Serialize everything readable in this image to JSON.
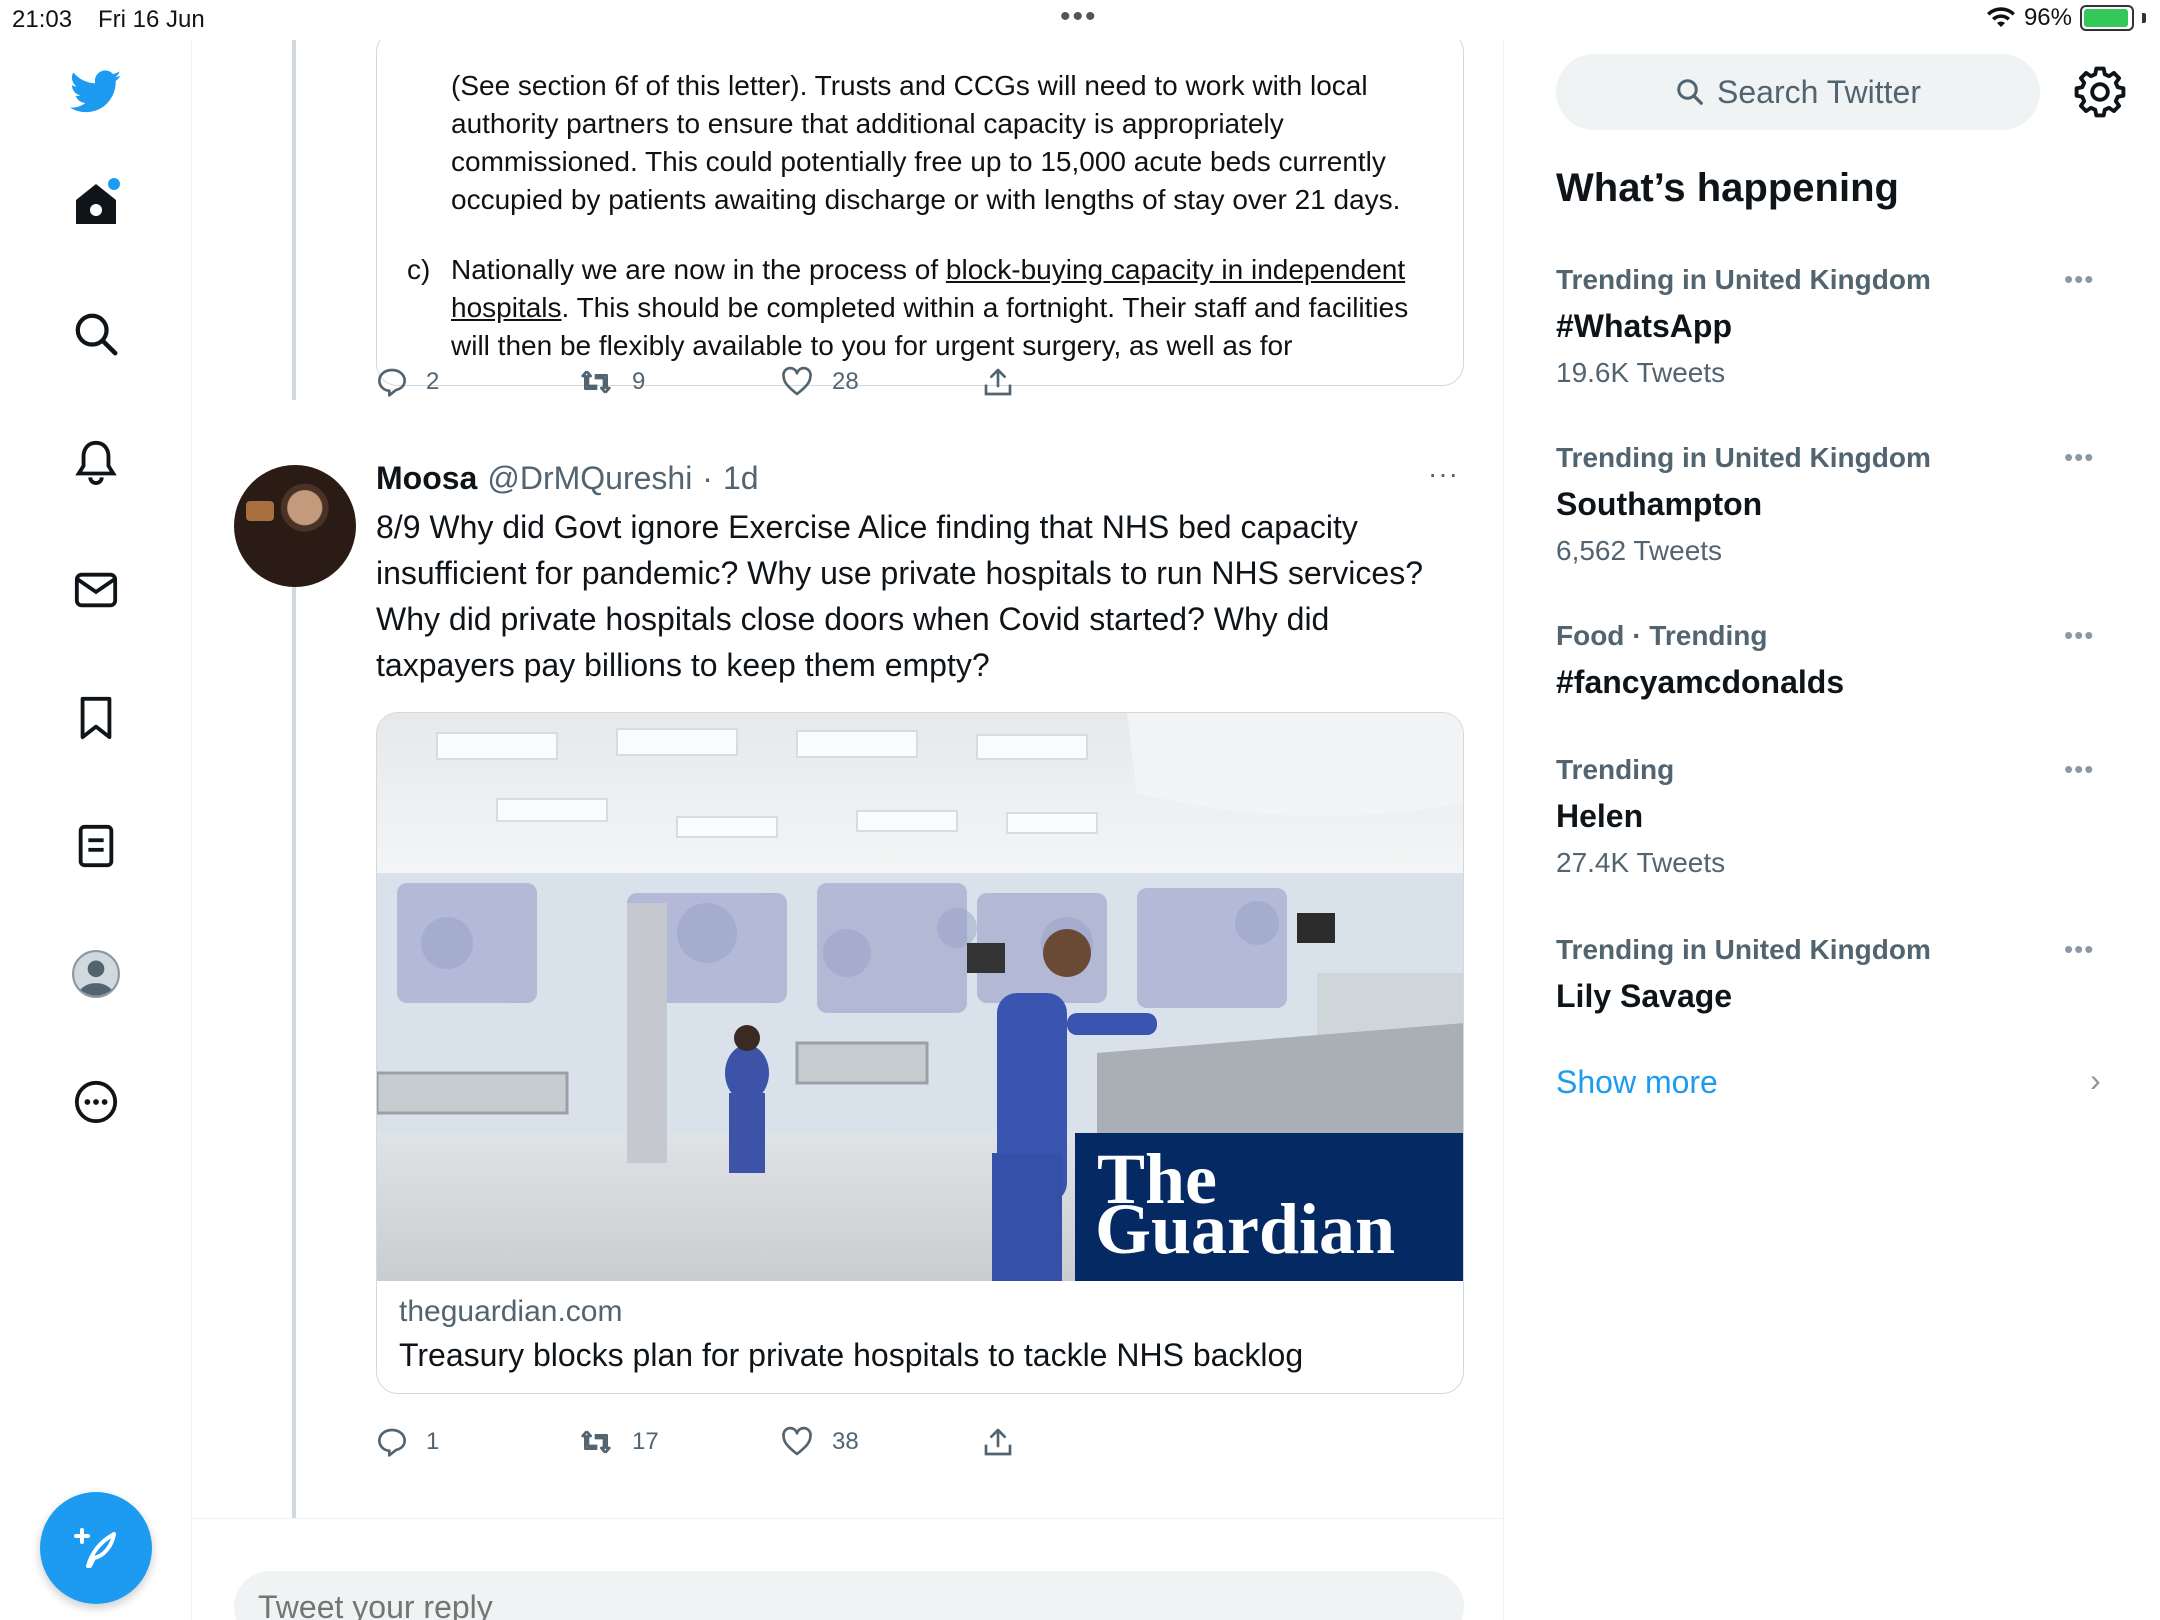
{
  "status_bar": {
    "time": "21:03",
    "date": "Fri 16 Jun",
    "battery": "96%",
    "battery_level": 0.96
  },
  "nav": {
    "items": [
      "twitter-logo",
      "home",
      "explore",
      "notifications",
      "messages",
      "bookmarks",
      "lists",
      "profile",
      "more"
    ],
    "compose_label": "Tweet"
  },
  "doc_excerpt": {
    "para1": "(See section 6f of this letter). Trusts and CCGs will need to work with local authority partners to ensure that additional capacity is appropriately commissioned. This could potentially free up to 15,000 acute beds currently occupied by patients awaiting discharge or with lengths of stay over 21 days.",
    "item_c_label": "c)",
    "item_c_prefix": "Nationally we are now in the process of ",
    "item_c_link": "block-buying capacity in independent hospitals",
    "item_c_rest": ". This should be completed within a fortnight. Their staff and facilities will then be flexibly available to you for urgent surgery, as well as for"
  },
  "tweet1_actions": {
    "replies": "2",
    "retweets": "9",
    "likes": "28"
  },
  "tweet2": {
    "name": "Moosa",
    "handle": "@DrMQureshi",
    "sep": "·",
    "time": "1d",
    "more": "···",
    "text": "8/9 Why did Govt ignore Exercise Alice finding that NHS bed capacity insufficient for pandemic? Why use private hospitals to run NHS services? Why did private hospitals close doors when Covid started? Why did taxpayers pay billions to keep them empty?",
    "card": {
      "logo_line1": "The",
      "logo_line2": "Guardian",
      "domain": "theguardian.com",
      "title": "Treasury blocks plan for private hospitals to tackle NHS backlog"
    },
    "actions": {
      "replies": "1",
      "retweets": "17",
      "likes": "38"
    }
  },
  "reply": {
    "placeholder": "Tweet your reply"
  },
  "sidebar": {
    "search_placeholder": "Search Twitter",
    "section_title": "What’s happening",
    "trends": [
      {
        "context": "Trending in United Kingdom",
        "name": "#WhatsApp",
        "count": "19.6K Tweets"
      },
      {
        "context": "Trending in United Kingdom",
        "name": "Southampton",
        "count": "6,562 Tweets"
      },
      {
        "context": "Food · Trending",
        "name": "#fancyamcdonalds",
        "count": ""
      },
      {
        "context": "Trending",
        "name": "Helen",
        "count": "27.4K Tweets"
      },
      {
        "context": "Trending in United Kingdom",
        "name": "Lily Savage",
        "count": ""
      }
    ],
    "show_more": "Show more"
  },
  "colors": {
    "accent": "#1d9bf0",
    "text": "#0f1419",
    "muted": "#536471",
    "guardian_blue": "#052962"
  }
}
